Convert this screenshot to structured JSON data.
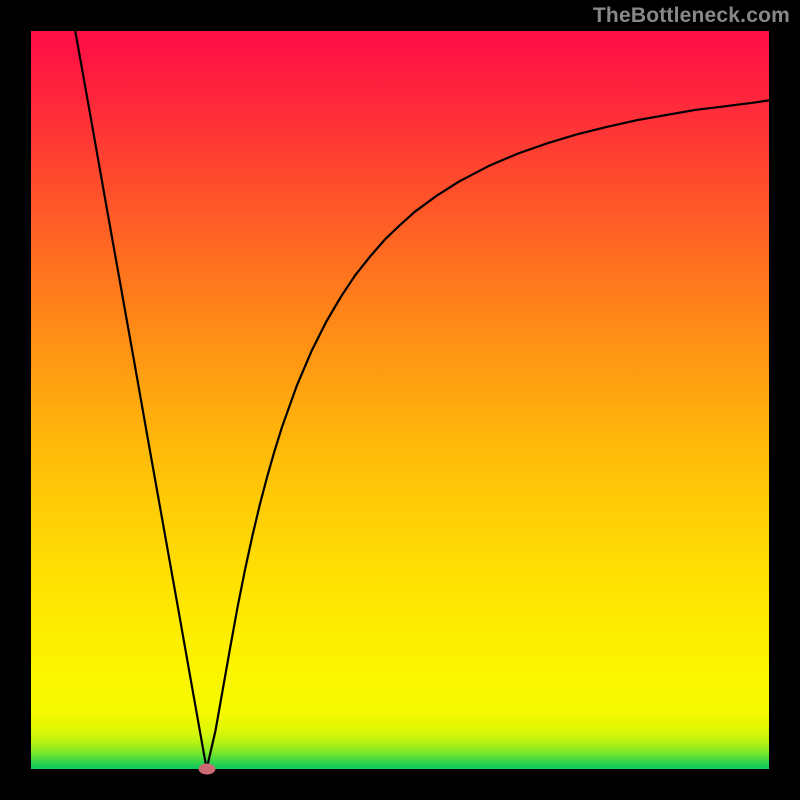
{
  "watermark": {
    "text": "TheBottleneck.com"
  },
  "chart_data": {
    "type": "line",
    "title": "",
    "xlabel": "",
    "ylabel": "",
    "xlim": [
      0,
      100
    ],
    "ylim": [
      0,
      100
    ],
    "grid": false,
    "series": [
      {
        "name": "bottleneck-curve",
        "x": [
          6.0,
          8,
          10,
          12,
          14,
          16,
          18,
          20,
          22,
          23.8,
          25,
          27,
          28,
          29,
          30,
          31,
          32,
          33,
          34,
          36,
          38,
          40,
          42,
          44,
          46,
          48,
          50,
          52,
          55,
          58,
          62,
          66,
          70,
          74,
          78,
          82,
          86,
          90,
          94,
          98,
          100
        ],
        "values": [
          100,
          88.8,
          77.5,
          66.3,
          55.1,
          43.8,
          32.6,
          21.4,
          10.1,
          0.0,
          5.2,
          16.5,
          22.0,
          27.0,
          31.6,
          35.8,
          39.6,
          43.1,
          46.3,
          51.9,
          56.6,
          60.6,
          64.0,
          67.0,
          69.5,
          71.8,
          73.7,
          75.5,
          77.7,
          79.6,
          81.7,
          83.4,
          84.8,
          86.0,
          87.0,
          87.9,
          88.6,
          89.3,
          89.8,
          90.3,
          90.6
        ]
      }
    ],
    "marker": {
      "x": 23.8,
      "y": 0.0,
      "color": "#cc6b74"
    },
    "background_gradient": {
      "top": "#ff0e46",
      "mid": "#ffb80a",
      "bottom": "#12c95c"
    }
  }
}
